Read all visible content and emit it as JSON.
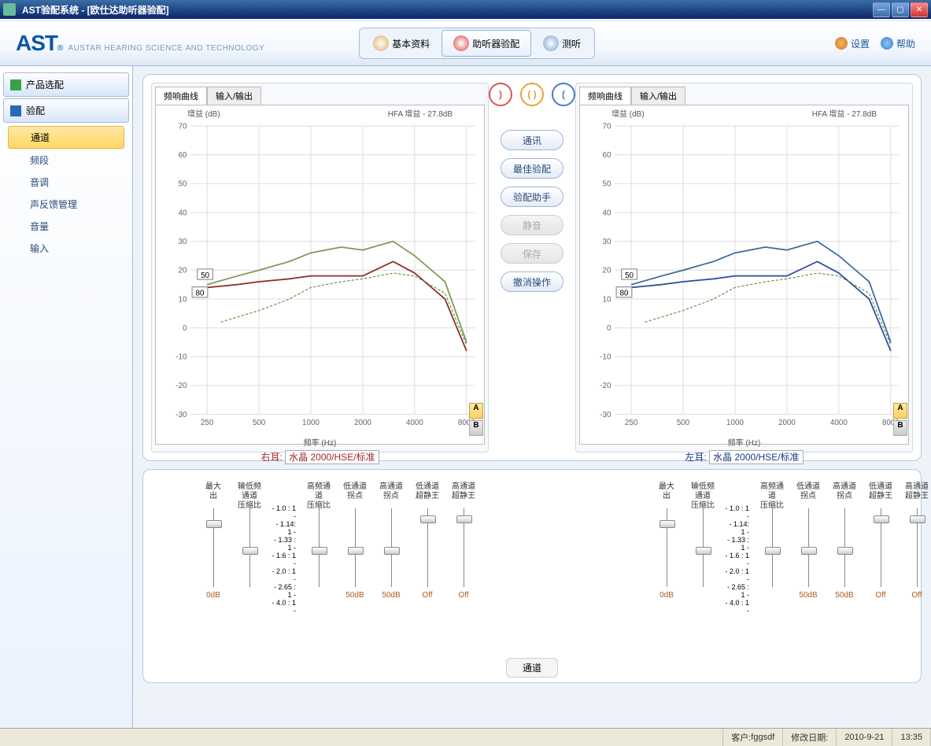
{
  "window": {
    "title": "AST验配系统 - [欧仕达助听器验配]"
  },
  "brand": {
    "logo": "AST",
    "reg": "®",
    "sub": "AUSTAR HEARING SCIENCE AND TECHNOLOGY"
  },
  "main_tabs": [
    {
      "label": "基本资料",
      "icon_color": "#e6a85c"
    },
    {
      "label": "助听器验配",
      "icon_color": "#d34a4a",
      "active": true
    },
    {
      "label": "测听",
      "icon_color": "#7a9fd0"
    }
  ],
  "header_links": {
    "settings": "设置",
    "help": "帮助"
  },
  "sidebar": {
    "cats": [
      {
        "label": "产品选配",
        "icon_color": "#3aa04a"
      },
      {
        "label": "验配",
        "icon_color": "#2a6ab0",
        "expanded": true
      }
    ],
    "items": [
      {
        "label": "通道",
        "active": true
      },
      {
        "label": "频段"
      },
      {
        "label": "音调"
      },
      {
        "label": "声反馈管理"
      },
      {
        "label": "音量"
      },
      {
        "label": "输入"
      }
    ]
  },
  "center_buttons": [
    {
      "label": "通讯"
    },
    {
      "label": "最佳验配"
    },
    {
      "label": "验配助手"
    },
    {
      "label": "静音",
      "disabled": true
    },
    {
      "label": "保存",
      "disabled": true
    },
    {
      "label": "撤消操作"
    }
  ],
  "chart_common": {
    "tab1": "频响曲线",
    "tab2": "输入/输出",
    "ytitle": "增益 (dB)",
    "hfa": "HFA 增益 - 27.8dB",
    "xlabel": "频率 (Hz)",
    "marker50": "50",
    "marker80": "80",
    "mem_a": "A",
    "mem_b": "B"
  },
  "ear_labels": {
    "right_prefix": "右耳:",
    "right_model": "水晶 2000/HSE/标准",
    "left_prefix": "左耳:",
    "left_model": "水晶 2000/HSE/标准"
  },
  "chart_data": [
    {
      "side": "right",
      "type": "line",
      "xlog": true,
      "xticks": [
        250,
        500,
        1000,
        2000,
        4000,
        8000
      ],
      "yticks": [
        -30,
        -20,
        -10,
        0,
        10,
        20,
        30,
        40,
        50,
        60,
        70
      ],
      "ylim": [
        -30,
        70
      ],
      "xlabel_key": "chart_common.xlabel",
      "ytitle_key": "chart_common.ytitle",
      "hfa_key": "chart_common.hfa",
      "series": [
        {
          "name": "50dB",
          "color": "#7a9a50",
          "x": [
            250,
            375,
            500,
            750,
            1000,
            1500,
            2000,
            3000,
            4000,
            6000,
            8000
          ],
          "y": [
            15,
            18,
            20,
            23,
            26,
            28,
            27,
            30,
            25,
            16,
            -5
          ]
        },
        {
          "name": "80dB",
          "color": "#8a2a2a",
          "x": [
            250,
            375,
            500,
            750,
            1000,
            1500,
            2000,
            3000,
            4000,
            6000,
            8000
          ],
          "y": [
            14,
            15,
            16,
            17,
            18,
            18,
            18,
            23,
            19,
            10,
            -8
          ]
        },
        {
          "name": "target",
          "color": "#5a8a3a",
          "dash": true,
          "x": [
            300,
            500,
            750,
            1000,
            1500,
            2000,
            3000,
            4000,
            6000,
            8000
          ],
          "y": [
            2,
            6,
            10,
            14,
            16,
            17,
            19,
            18,
            12,
            -6
          ]
        }
      ],
      "markers": {
        "50": {
          "x": 260,
          "y": 17,
          "box": true
        },
        "80": {
          "x": 250,
          "y": 14,
          "box": true
        }
      }
    },
    {
      "side": "left",
      "type": "line",
      "xlog": true,
      "xticks": [
        250,
        500,
        1000,
        2000,
        4000,
        8000
      ],
      "yticks": [
        -30,
        -20,
        -10,
        0,
        10,
        20,
        30,
        40,
        50,
        60,
        70
      ],
      "ylim": [
        -30,
        70
      ],
      "series": [
        {
          "name": "50dB",
          "color": "#3a6a9a",
          "x": [
            250,
            375,
            500,
            750,
            1000,
            1500,
            2000,
            3000,
            4000,
            6000,
            8000
          ],
          "y": [
            15,
            18,
            20,
            23,
            26,
            28,
            27,
            30,
            25,
            16,
            -5
          ]
        },
        {
          "name": "80dB",
          "color": "#2a4a9a",
          "x": [
            250,
            375,
            500,
            750,
            1000,
            1500,
            2000,
            3000,
            4000,
            6000,
            8000
          ],
          "y": [
            14,
            15,
            16,
            17,
            18,
            18,
            18,
            23,
            19,
            10,
            -8
          ]
        },
        {
          "name": "target",
          "color": "#5a8a3a",
          "dash": true,
          "x": [
            300,
            500,
            750,
            1000,
            1500,
            2000,
            3000,
            4000,
            6000,
            8000
          ],
          "y": [
            2,
            6,
            10,
            14,
            16,
            17,
            19,
            18,
            12,
            -6
          ]
        }
      ]
    }
  ],
  "sliders": {
    "cols": [
      {
        "head": "最大\n出",
        "foot": "0dB",
        "pos": 0.12
      },
      {
        "head": "输低频通道\n压缩比",
        "foot": "",
        "pos": 0.5
      },
      {
        "ratio_labels": [
          "1.0 : 1",
          "1.14: 1",
          "1.33 : 1",
          "1.6 : 1",
          "2.0 : 1",
          "2.65 : 1",
          "4.0 : 1"
        ]
      },
      {
        "head": "高频通道\n压缩比",
        "foot": "",
        "pos": 0.5
      },
      {
        "head": "低通道\n拐点",
        "foot": "50dB",
        "pos": 0.5
      },
      {
        "head": "高通道\n拐点",
        "foot": "50dB",
        "pos": 0.5
      },
      {
        "head": "低通道\n超静王",
        "foot": "Off",
        "pos": 0.05,
        "squiggle": true
      },
      {
        "head": "高通道\n超静王",
        "foot": "Off",
        "pos": 0.05,
        "squiggle": true
      }
    ]
  },
  "bottom_label": "通道",
  "status": {
    "client_label": "客户:",
    "client": "fggsdf",
    "date_label": "修改日期:",
    "date": "2010-9-21",
    "time": "13:35"
  }
}
